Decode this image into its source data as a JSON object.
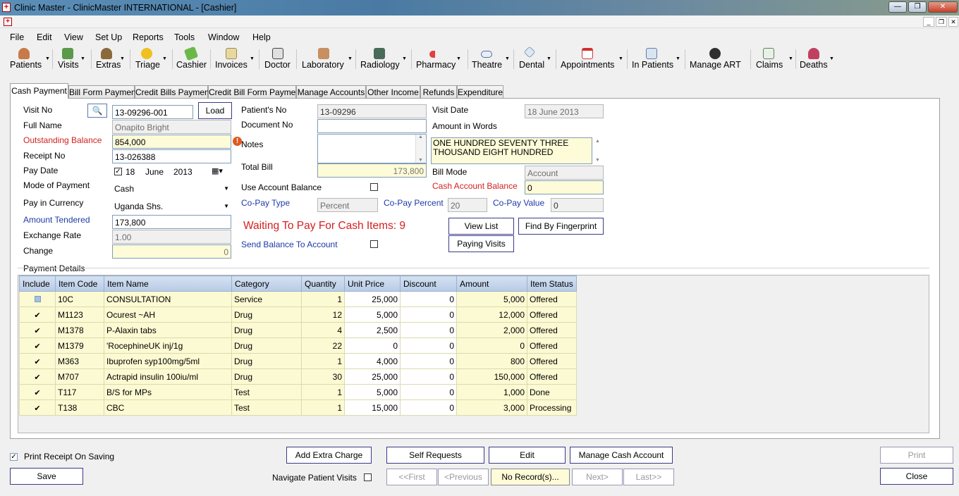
{
  "titlebar": {
    "title": "Clinic Master - ClinicMaster INTERNATIONAL - [Cashier]"
  },
  "menu": [
    "File",
    "Edit",
    "View",
    "Set Up",
    "Reports",
    "Tools",
    "Window",
    "Help"
  ],
  "toolbar": [
    "Patients",
    "Visits",
    "Extras",
    "Triage",
    "Cashier",
    "Invoices",
    "Doctor",
    "Laboratory",
    "Radiology",
    "Pharmacy",
    "Theatre",
    "Dental",
    "Appointments",
    "In Patients",
    "Manage ART",
    "Claims",
    "Deaths"
  ],
  "tabs": [
    "Cash Payment",
    "Bill Form Payment",
    "Credit Bills Payment",
    "Credit Bill Form Payment",
    "Manage Accounts",
    "Other Income",
    "Refunds",
    "Expenditure"
  ],
  "form": {
    "visit_no_label": "Visit No",
    "visit_no": "13-09296-001",
    "load_label": "Load",
    "full_name_label": "Full Name",
    "full_name": "Onapito Bright",
    "outstanding_label": "Outstanding Balance",
    "outstanding": "854,000",
    "receipt_label": "Receipt No",
    "receipt": "13-026388",
    "pay_date_label": "Pay Date",
    "pay_day": "18",
    "pay_month": "June",
    "pay_year": "2013",
    "mode_label": "Mode of Payment",
    "mode": "Cash",
    "currency_label": "Pay in Currency",
    "currency": "Uganda Shs.",
    "tendered_label": "Amount Tendered",
    "tendered": "173,800",
    "exchange_label": "Exchange Rate",
    "exchange": "1.00",
    "change_label": "Change",
    "change": "0",
    "patient_no_label": "Patient's No",
    "patient_no": "13-09296",
    "document_label": "Document No",
    "document": "",
    "notes_label": "Notes",
    "notes": "",
    "total_label": "Total Bill",
    "total": "173,800",
    "use_account_label": "Use Account Balance",
    "copay_type_label": "Co-Pay Type",
    "copay_type": "Percent",
    "copay_percent_label": "Co-Pay Percent",
    "copay_percent": "20",
    "copay_value_label": "Co-Pay Value",
    "copay_value": "0",
    "waiting": "Waiting To Pay For Cash Items: 9",
    "send_balance_label": "Send Balance To Account",
    "visit_date_label": "Visit Date",
    "visit_date": "18 June 2013",
    "words_label": "Amount in Words",
    "words": "ONE HUNDRED SEVENTY THREE THOUSAND  EIGHT HUNDRED",
    "bill_mode_label": "Bill Mode",
    "bill_mode": "Account",
    "cash_account_label": "Cash Account Balance",
    "cash_account": "0",
    "view_list": "View List",
    "fingerprint": "Find By Fingerprint",
    "paying_visits": "Paying Visits",
    "payment_details_label": "Payment Details"
  },
  "grid": {
    "headers": [
      "Include",
      "Item Code",
      "Item Name",
      "Category",
      "Quantity",
      "Unit Price",
      "Discount",
      "Amount",
      "Item Status"
    ],
    "rows": [
      {
        "inc": false,
        "code": "10C",
        "name": "CONSULTATION",
        "cat": "Service",
        "qty": "1",
        "price": "25,000",
        "disc": "0",
        "amt": "5,000",
        "status": "Offered"
      },
      {
        "inc": true,
        "code": "M1123",
        "name": "Ocurest ~AH",
        "cat": "Drug",
        "qty": "12",
        "price": "5,000",
        "disc": "0",
        "amt": "12,000",
        "status": "Offered"
      },
      {
        "inc": true,
        "code": "M1378",
        "name": "P-Alaxin tabs",
        "cat": "Drug",
        "qty": "4",
        "price": "2,500",
        "disc": "0",
        "amt": "2,000",
        "status": "Offered"
      },
      {
        "inc": true,
        "code": "M1379",
        "name": "'RocephineUK inj/1g",
        "cat": "Drug",
        "qty": "22",
        "price": "0",
        "disc": "0",
        "amt": "0",
        "status": "Offered"
      },
      {
        "inc": true,
        "code": "M363",
        "name": "Ibuprofen syp100mg/5ml",
        "cat": "Drug",
        "qty": "1",
        "price": "4,000",
        "disc": "0",
        "amt": "800",
        "status": "Offered"
      },
      {
        "inc": true,
        "code": "M707",
        "name": "Actrapid insulin 100iu/ml",
        "cat": "Drug",
        "qty": "30",
        "price": "25,000",
        "disc": "0",
        "amt": "150,000",
        "status": "Offered"
      },
      {
        "inc": true,
        "code": "T117",
        "name": "B/S for MPs",
        "cat": "Test",
        "qty": "1",
        "price": "5,000",
        "disc": "0",
        "amt": "1,000",
        "status": "Done"
      },
      {
        "inc": true,
        "code": "T138",
        "name": "CBC",
        "cat": "Test",
        "qty": "1",
        "price": "15,000",
        "disc": "0",
        "amt": "3,000",
        "status": "Processing"
      }
    ]
  },
  "bottom": {
    "print_receipt": "Print Receipt On Saving",
    "save": "Save",
    "add_extra": "Add Extra Charge",
    "self_requests": "Self Requests",
    "edit": "Edit",
    "manage_cash": "Manage Cash Account",
    "print": "Print",
    "close": "Close",
    "navigate": "Navigate Patient Visits",
    "first": "<<First",
    "previous": "<Previous",
    "no_records": "No Record(s)...",
    "next": "Next>",
    "last": "Last>>"
  },
  "colors": {
    "label_red": "#d42020",
    "label_blue": "#1c3aa8",
    "readonly_yellow": "#fdfbd8",
    "grid_row": "#fcfad2"
  }
}
